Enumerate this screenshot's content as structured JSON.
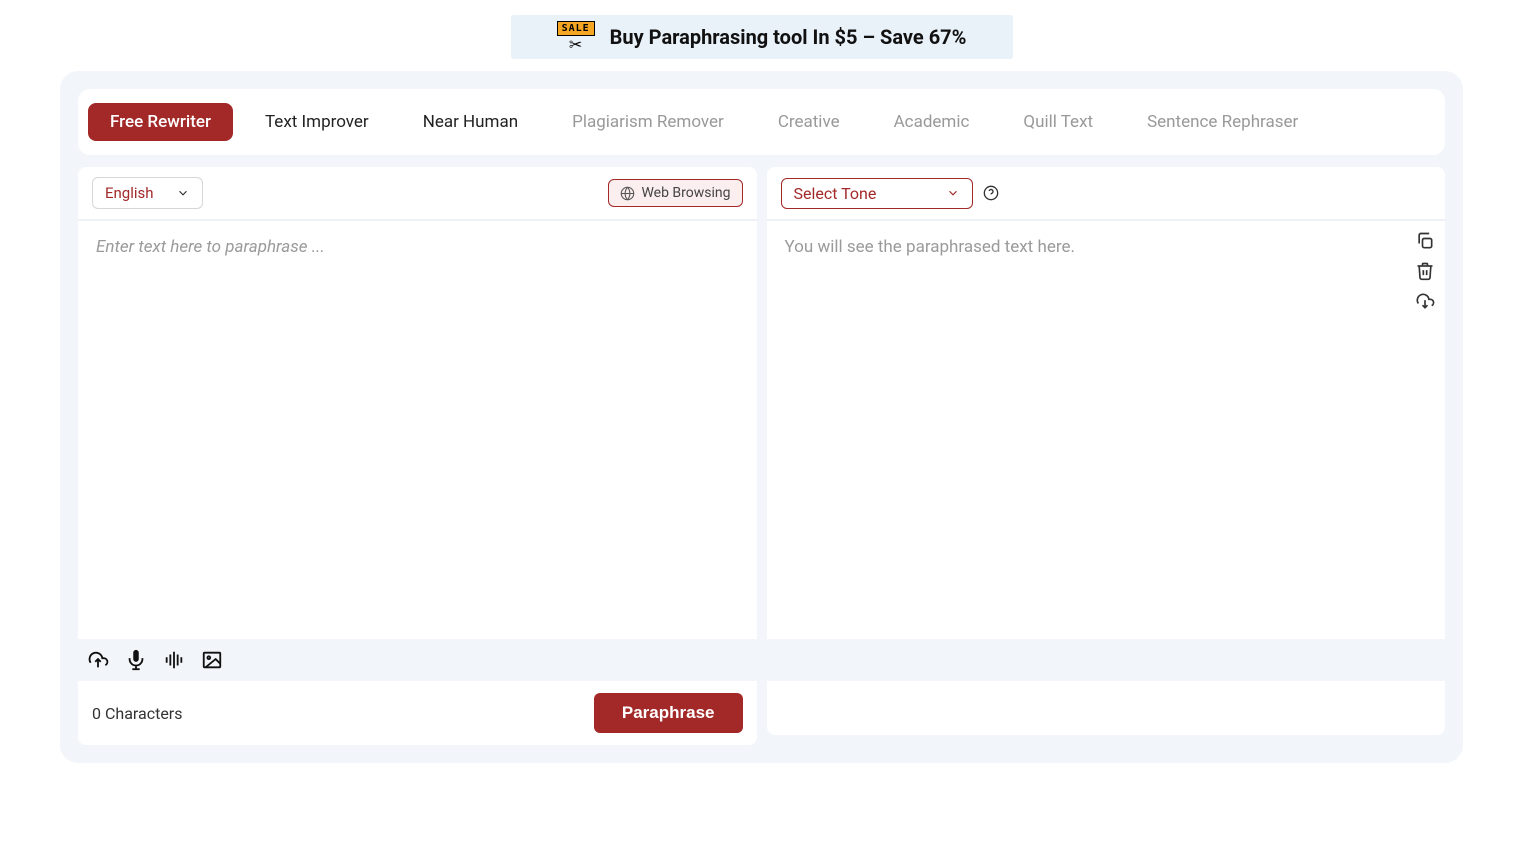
{
  "banner": {
    "sale_tag": "SALE",
    "text": "Buy Paraphrasing tool In $5 – Save 67%"
  },
  "tabs": [
    {
      "label": "Free Rewriter",
      "state": "active"
    },
    {
      "label": "Text Improver",
      "state": "enabled"
    },
    {
      "label": "Near Human",
      "state": "enabled"
    },
    {
      "label": "Plagiarism Remover",
      "state": "disabled"
    },
    {
      "label": "Creative",
      "state": "disabled"
    },
    {
      "label": "Academic",
      "state": "disabled"
    },
    {
      "label": "Quill Text",
      "state": "disabled"
    },
    {
      "label": "Sentence Rephraser",
      "state": "disabled"
    }
  ],
  "left": {
    "language": "English",
    "web_browsing_label": "Web Browsing",
    "placeholder": "Enter text here to paraphrase ...",
    "char_count": "0 Characters",
    "paraphrase_button": "Paraphrase"
  },
  "right": {
    "tone_label": "Select Tone",
    "placeholder": "You will see the paraphrased text here."
  }
}
